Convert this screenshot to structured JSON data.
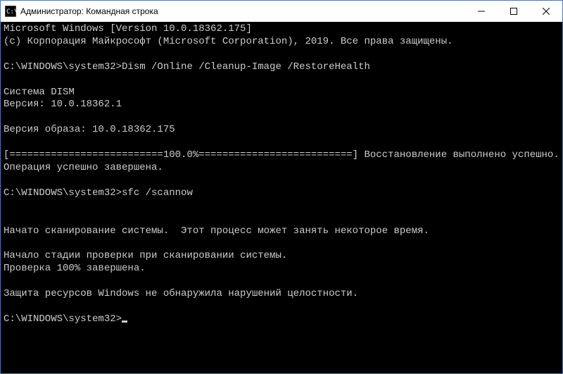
{
  "titlebar": {
    "text": "Администратор: Командная строка"
  },
  "terminal": {
    "lines": [
      "Microsoft Windows [Version 10.0.18362.175]",
      "(c) Корпорация Майкрософт (Microsoft Corporation), 2019. Все права защищены.",
      "",
      "C:\\WINDOWS\\system32>Dism /Online /Cleanup-Image /RestoreHealth",
      "",
      "Cистема DISM",
      "Версия: 10.0.18362.1",
      "",
      "Версия образа: 10.0.18362.175",
      "",
      "[==========================100.0%==========================] Восстановление выполнено успешно.",
      "Операция успешно завершена.",
      "",
      "C:\\WINDOWS\\system32>sfc /scannow",
      "",
      "",
      "Начато сканирование системы.  Этот процесс может занять некоторое время.",
      "",
      "Начало стадии проверки при сканировании системы.",
      "Проверка 100% завершена.",
      "",
      "Защита ресурсов Windows не обнаружила нарушений целостности.",
      "",
      "C:\\WINDOWS\\system32>"
    ]
  }
}
